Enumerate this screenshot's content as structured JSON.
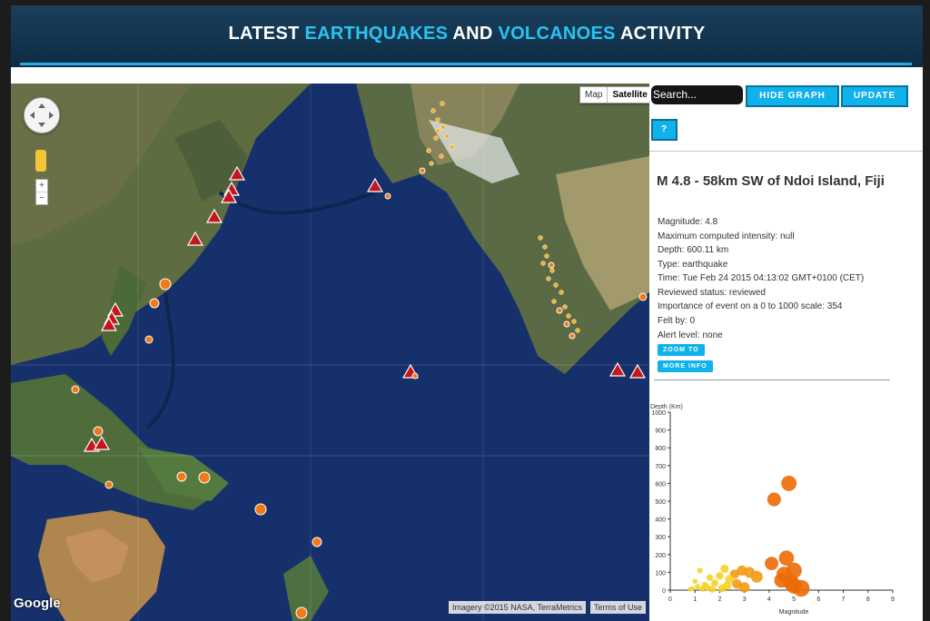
{
  "header": {
    "title_part1": "LATEST ",
    "title_part2": "EARTHQUAKES",
    "title_part3": " AND ",
    "title_part4": "VOLCANOES",
    "title_part5": " ACTIVITY",
    "accent_color": "#29c4f2"
  },
  "map": {
    "type_buttons": [
      "Map",
      "Satellite"
    ],
    "selected_type": "Satellite",
    "zoom_in": "+",
    "zoom_out": "−",
    "google_logo": "Google",
    "imagery_credit": "Imagery ©2015 NASA, TerraMetrics",
    "terms": "Terms of Use",
    "icons": {
      "pan": "pan-control-icon",
      "pegman": "street-view-pegman-icon",
      "volcano": "volcano-triangle-icon",
      "quake": "earthquake-circle-icon"
    }
  },
  "controls": {
    "search_placeholder": "Search...",
    "hide_graph": "HIDE GRAPH",
    "update": "UPDATE",
    "help": "?"
  },
  "event": {
    "title": "M 4.8 - 58km SW of Ndoi Island, Fiji",
    "details": [
      "Magnitude: 4.8",
      "Maximum computed intensity: null",
      "Depth: 600.11 km",
      "Type: earthquake",
      "Time: Tue Feb 24 2015 04:13:02 GMT+0100 (CET)",
      "Reviewed status: reviewed",
      "Importance of event on a 0 to 1000 scale: 354",
      "Felt by: 0",
      "Alert level: none"
    ],
    "zoom_to": "ZOOM TO",
    "more_info": "MORE INFO"
  },
  "chart_data": {
    "type": "scatter",
    "ylabel": "Depth (Km)",
    "xlabel": "Magnitude",
    "xlim": [
      0,
      9
    ],
    "ylim": [
      0,
      1000
    ],
    "x_ticks": [
      "0",
      "1",
      "2",
      "3",
      "4",
      "5",
      "6",
      "7",
      "8",
      "9"
    ],
    "y_ticks": [
      "0",
      "100",
      "200",
      "300",
      "400",
      "500",
      "600",
      "700",
      "800",
      "900",
      "1000"
    ],
    "points": [
      {
        "x": 4.8,
        "y": 600
      },
      {
        "x": 4.2,
        "y": 510
      },
      {
        "x": 4.7,
        "y": 180
      },
      {
        "x": 4.1,
        "y": 150
      },
      {
        "x": 5.0,
        "y": 110
      },
      {
        "x": 4.6,
        "y": 90
      },
      {
        "x": 4.5,
        "y": 55
      },
      {
        "x": 4.9,
        "y": 40
      },
      {
        "x": 5.3,
        "y": 10
      },
      {
        "x": 5.0,
        "y": 25
      },
      {
        "x": 3.5,
        "y": 75
      },
      {
        "x": 3.2,
        "y": 100
      },
      {
        "x": 2.9,
        "y": 110
      },
      {
        "x": 2.6,
        "y": 90
      },
      {
        "x": 2.4,
        "y": 60
      },
      {
        "x": 2.2,
        "y": 120
      },
      {
        "x": 2.0,
        "y": 80
      },
      {
        "x": 1.8,
        "y": 40
      },
      {
        "x": 1.6,
        "y": 70
      },
      {
        "x": 1.4,
        "y": 30
      },
      {
        "x": 1.2,
        "y": 110
      },
      {
        "x": 1.1,
        "y": 20
      },
      {
        "x": 0.9,
        "y": 10
      },
      {
        "x": 0.8,
        "y": 5
      },
      {
        "x": 1.0,
        "y": 50
      },
      {
        "x": 1.5,
        "y": 15
      },
      {
        "x": 2.1,
        "y": 10
      },
      {
        "x": 2.7,
        "y": 35
      },
      {
        "x": 3.0,
        "y": 15
      },
      {
        "x": 1.7,
        "y": 5
      },
      {
        "x": 2.3,
        "y": 25
      },
      {
        "x": 1.3,
        "y": 8
      }
    ]
  }
}
